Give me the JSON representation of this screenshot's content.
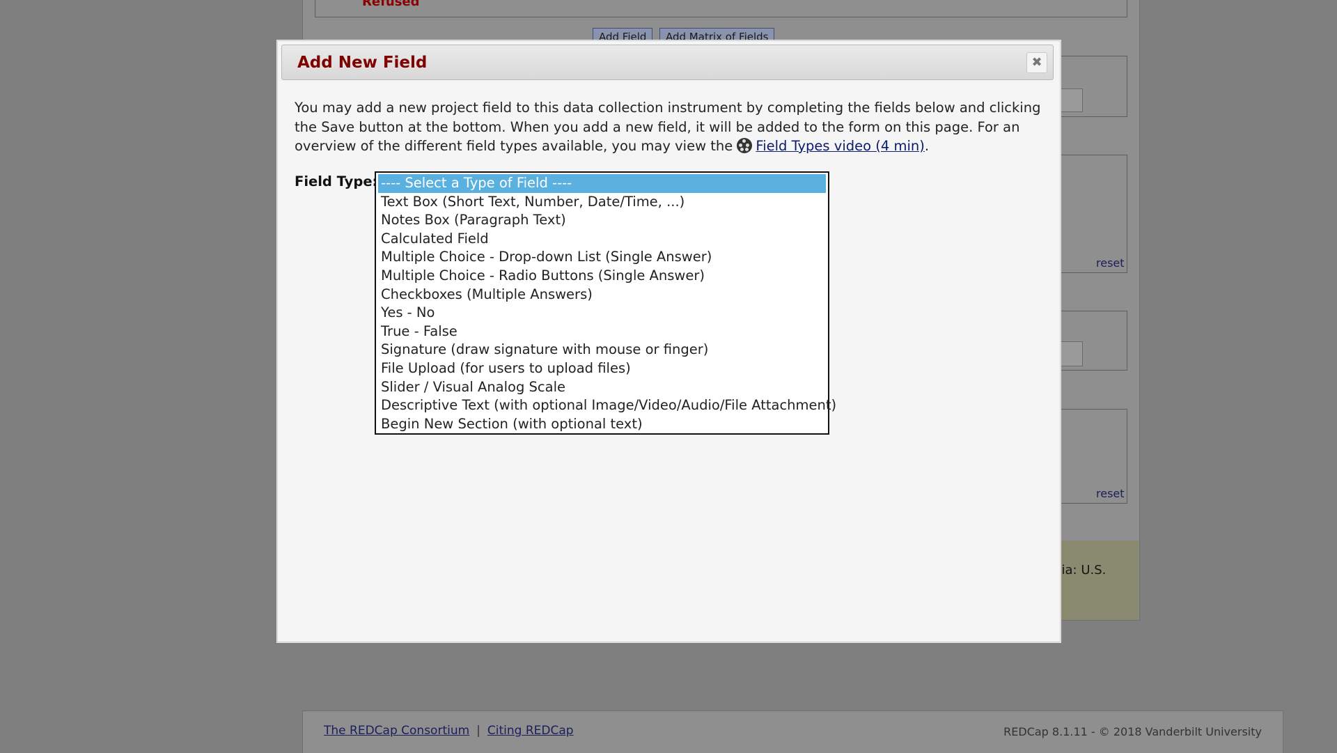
{
  "background": {
    "refused_label": "Refused",
    "add_field_button": "Add Field",
    "add_matrix_button": "Add Matrix of Fields",
    "reset_links": [
      "reset",
      "reset"
    ],
    "info_partial_text": "rgia: U.S.",
    "footer": {
      "consortium_link": "The REDCap Consortium",
      "separator": "|",
      "citing_link": "Citing REDCap",
      "copyright": "REDCap 8.1.11 - © 2018 Vanderbilt University"
    }
  },
  "dialog": {
    "title": "Add New Field",
    "close_glyph": "✖",
    "intro_text": "You may add a new project field to this data collection instrument by completing the fields below and clicking the Save button at the bottom. When you add a new field, it will be added to the form on this page. For an overview of the different field types available, you may view the",
    "video_link": "Field Types video (4 min)",
    "intro_end": ".",
    "field_type_label": "Field Type:",
    "field_type_options": [
      "---- Select a Type of Field ----",
      "Text Box (Short Text, Number, Date/Time, ...)",
      "Notes Box (Paragraph Text)",
      "Calculated Field",
      "Multiple Choice - Drop-down List (Single Answer)",
      "Multiple Choice - Radio Buttons (Single Answer)",
      "Checkboxes (Multiple Answers)",
      "Yes - No",
      "True - False",
      "Signature (draw signature with mouse or finger)",
      "File Upload (for users to upload files)",
      "Slider / Visual Analog Scale",
      "Descriptive Text (with optional Image/Video/Audio/File Attachment)",
      "Begin New Section (with optional text)"
    ],
    "selected_index": 0
  },
  "colors": {
    "title": "#800000",
    "selected_option": "#5ab1e0",
    "overlay": "#7f7f7f"
  }
}
